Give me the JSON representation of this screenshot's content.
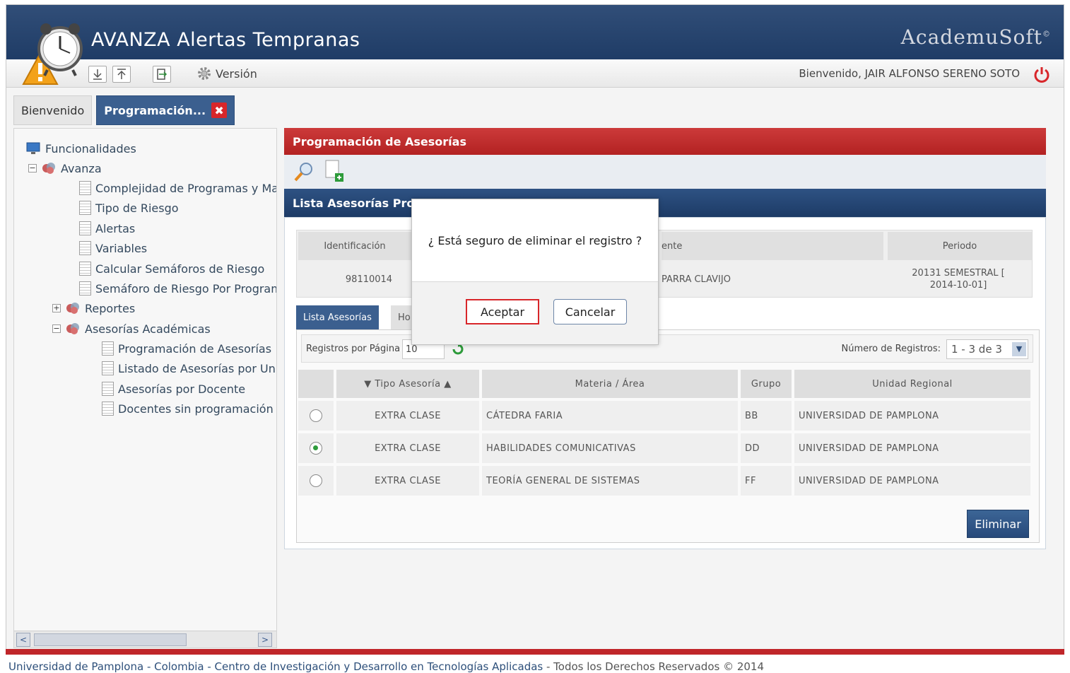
{
  "header": {
    "title": "AVANZA Alertas Tempranas",
    "brand": "AcademuSoft",
    "brand_mark": "©"
  },
  "toolbar": {
    "version_label": "Versión",
    "welcome": "Bienvenido, JAIR ALFONSO SERENO SOTO"
  },
  "tabs": [
    {
      "label": "Bienvenido"
    },
    {
      "label": "Programación...",
      "close": "✖"
    }
  ],
  "tree": {
    "root": "Funcionalidades",
    "items": [
      {
        "label": "Avanza",
        "toggle": "−"
      },
      {
        "label": "Complejidad de Programas y Mate"
      },
      {
        "label": "Tipo de Riesgo"
      },
      {
        "label": "Alertas"
      },
      {
        "label": "Variables"
      },
      {
        "label": "Calcular Semáforos de Riesgo"
      },
      {
        "label": "Semáforo de Riesgo Por Program"
      },
      {
        "label": "Reportes",
        "toggle": "+"
      },
      {
        "label": "Asesorías Académicas",
        "toggle": "−"
      },
      {
        "label": "Programación de Asesorías"
      },
      {
        "label": "Listado de Asesorías por Uni"
      },
      {
        "label": "Asesorías por Docente"
      },
      {
        "label": "Docentes sin programación A"
      }
    ],
    "scroll_left": "<",
    "scroll_right": ">"
  },
  "main": {
    "title": "Programación de Asesorías",
    "list_title": "Lista Asesorías Pro",
    "info": {
      "headers": [
        "Identificación",
        "ente",
        "Periodo"
      ],
      "values": [
        "98110014",
        "PARRA CLAVIJO",
        "20131 SEMESTRAL [ 2014-10-01]"
      ]
    },
    "subtabs": {
      "active": "Lista Asesorías",
      "inactive": "Ho"
    },
    "pager": {
      "rows_per_page_label": "Registros por Página",
      "rows_per_page_value": "10",
      "count_label": "Número de Registros:",
      "count_value": "1 - 3 de 3"
    },
    "grid": {
      "headers": [
        "▼ Tipo Asesoría ▲",
        "Materia / Área",
        "Grupo",
        "Unidad Regional"
      ],
      "rows": [
        {
          "tipo": "EXTRA CLASE",
          "materia": "CÁTEDRA FARIA",
          "grupo": "BB",
          "unidad": "UNIVERSIDAD DE PAMPLONA",
          "selected": false
        },
        {
          "tipo": "EXTRA CLASE",
          "materia": "HABILIDADES COMUNICATIVAS",
          "grupo": "DD",
          "unidad": "UNIVERSIDAD DE PAMPLONA",
          "selected": true
        },
        {
          "tipo": "EXTRA CLASE",
          "materia": "TEORÍA GENERAL DE SISTEMAS",
          "grupo": "FF",
          "unidad": "UNIVERSIDAD DE PAMPLONA",
          "selected": false
        }
      ]
    },
    "delete_label": "Eliminar"
  },
  "dialog": {
    "message": "¿ Está seguro de eliminar el registro ?",
    "ok_label": "Aceptar",
    "cancel_label": "Cancelar"
  },
  "footer": {
    "text": "Universidad de Pamplona - Colombia - Centro de Investigación y Desarrollo en Tecnologías Aplicadas",
    "rights": " - Todos los Derechos Reservados © 2014"
  },
  "colors": {
    "header_blue": "#1f3c66",
    "accent_red": "#b32222",
    "active_tab": "#3b5f8f",
    "selected_radio": "#2e9b3b"
  }
}
